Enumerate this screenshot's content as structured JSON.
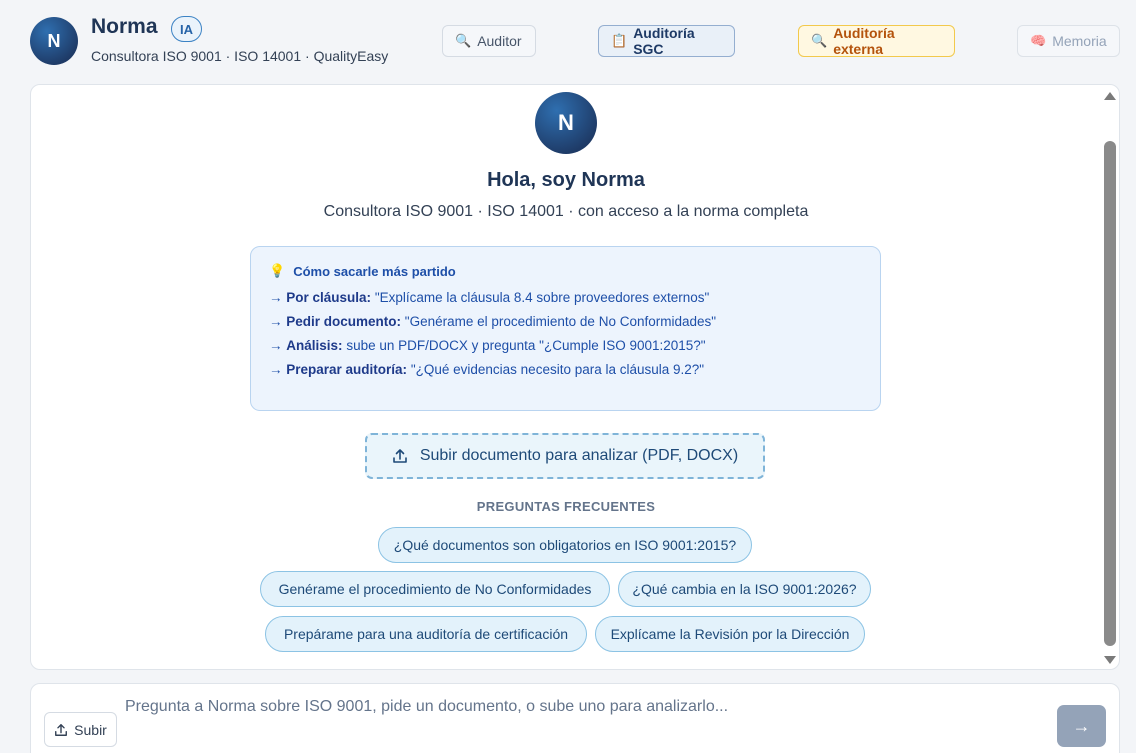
{
  "header": {
    "avatar_initial": "N",
    "name": "Norma",
    "badge": "IA",
    "subtitle": "Consultora ISO 9001 · ISO 14001 · QualityEasy",
    "buttons": [
      {
        "label": "Auditor",
        "icon": "magnifier-icon"
      },
      {
        "label": "Auditoría SGC",
        "icon": "clipboard-icon"
      },
      {
        "label": "Auditoría externa",
        "icon": "magnifier-icon"
      },
      {
        "label": "Memoria",
        "icon": "brain-icon"
      }
    ]
  },
  "welcome": {
    "avatar_initial": "N",
    "title": "Hola, soy Norma",
    "subtitle": "Consultora ISO 9001 · ISO 14001 · con acceso a la norma completa"
  },
  "tips": {
    "title": "Cómo sacarle más partido",
    "items": [
      {
        "label": "Por cláusula:",
        "text": "\"Explícame la cláusula 8.4 sobre proveedores externos\""
      },
      {
        "label": "Pedir documento:",
        "text": "\"Genérame el procedimiento de No Conformidades\""
      },
      {
        "label": "Análisis:",
        "text": "sube un PDF/DOCX y pregunta \"¿Cumple ISO 9001:2015?\""
      },
      {
        "label": "Preparar auditoría:",
        "text": "\"¿Qué evidencias necesito para la cláusula 9.2?\""
      }
    ]
  },
  "upload": {
    "label": "Subir documento para analizar (PDF, DOCX)"
  },
  "faq": {
    "title": "PREGUNTAS FRECUENTES",
    "chips": [
      "¿Qué documentos son obligatorios en ISO 9001:2015?",
      "Genérame el procedimiento de No Conformidades",
      "¿Qué cambia en la ISO 9001:2026?",
      "Prepárame para una auditoría de certificación",
      "Explícame la Revisión por la Dirección"
    ]
  },
  "input": {
    "upload_label": "Subir",
    "placeholder": "Pregunta a Norma sobre ISO 9001, pide un documento, o sube uno para analizarlo...",
    "value": "",
    "send_icon": "→"
  }
}
